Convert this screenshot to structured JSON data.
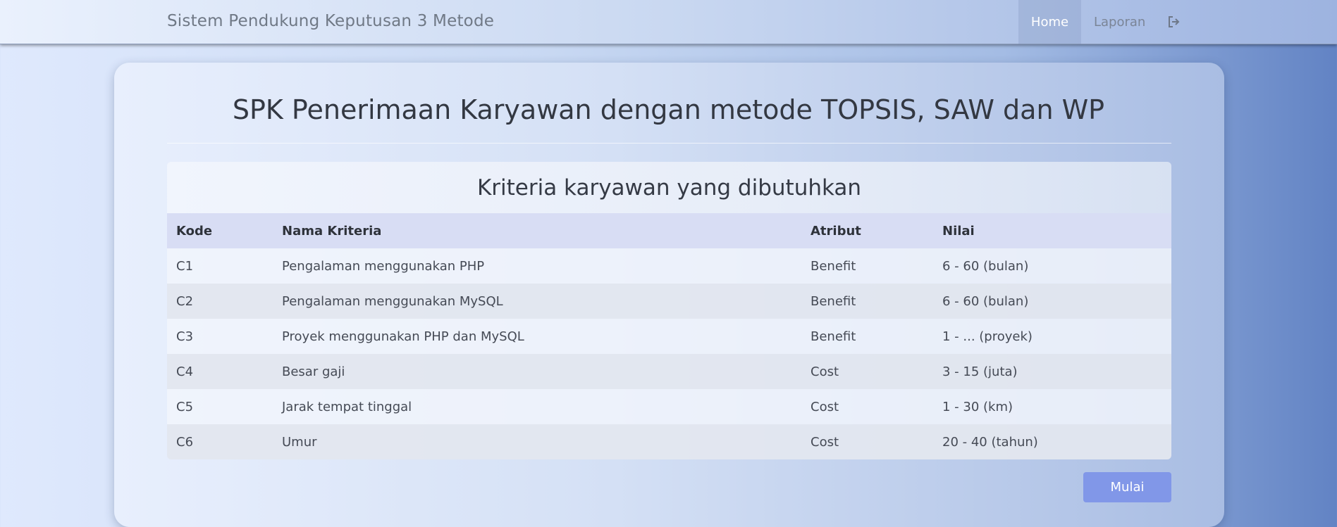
{
  "navbar": {
    "brand": "Sistem Pendukung Keputusan 3 Metode",
    "links": [
      {
        "label": "Home",
        "active": true
      },
      {
        "label": "Laporan",
        "active": false
      }
    ],
    "logout_icon": "logout-icon"
  },
  "main": {
    "title": "SPK Penerimaan Karyawan dengan metode TOPSIS, SAW dan WP",
    "panel_title": "Kriteria karyawan yang dibutuhkan",
    "table": {
      "headers": [
        "Kode",
        "Nama Kriteria",
        "Atribut",
        "Nilai"
      ],
      "rows": [
        [
          "C1",
          "Pengalaman menggunakan PHP",
          "Benefit",
          "6 - 60 (bulan)"
        ],
        [
          "C2",
          "Pengalaman menggunakan MySQL",
          "Benefit",
          "6 - 60 (bulan)"
        ],
        [
          "C3",
          "Proyek menggunakan PHP dan MySQL",
          "Benefit",
          "1 - ... (proyek)"
        ],
        [
          "C4",
          "Besar gaji",
          "Cost",
          "3 - 15 (juta)"
        ],
        [
          "C5",
          "Jarak tempat tinggal",
          "Cost",
          "1 - 30 (km)"
        ],
        [
          "C6",
          "Umur",
          "Cost",
          "20 - 40 (tahun)"
        ]
      ]
    },
    "start_button": "Mulai"
  },
  "colors": {
    "accent": "#8197e8",
    "table_header": "#d8ddf4"
  }
}
